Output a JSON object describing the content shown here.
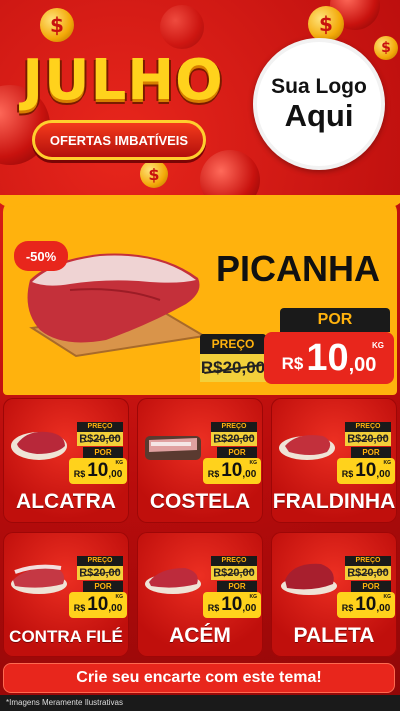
{
  "header": {
    "title": "JULHO",
    "subtitle": "OFERTAS IMBATÍVEIS",
    "logo_line1": "Sua Logo",
    "logo_line2": "Aqui",
    "coin_symbol": "$"
  },
  "featured": {
    "discount": "-50%",
    "name": "PICANHA",
    "old_label": "PREÇO",
    "old_price": "R$20,00",
    "new_label": "POR",
    "currency": "R$",
    "price_int": "10",
    "price_dec": ",00",
    "unit": "KG"
  },
  "products": [
    {
      "name": "ALCATRA",
      "old_label": "PREÇO",
      "old_price": "R$20,00",
      "new_label": "POR",
      "currency": "R$",
      "price_int": "10",
      "price_dec": ",00",
      "unit": "KG"
    },
    {
      "name": "COSTELA",
      "old_label": "PREÇO",
      "old_price": "R$20,00",
      "new_label": "POR",
      "currency": "R$",
      "price_int": "10",
      "price_dec": ",00",
      "unit": "KG"
    },
    {
      "name": "FRALDINHA",
      "old_label": "PREÇO",
      "old_price": "R$20,00",
      "new_label": "POR",
      "currency": "R$",
      "price_int": "10",
      "price_dec": ",00",
      "unit": "KG"
    },
    {
      "name": "CONTRA FILÉ",
      "old_label": "PREÇO",
      "old_price": "R$20,00",
      "new_label": "POR",
      "currency": "R$",
      "price_int": "10",
      "price_dec": ",00",
      "unit": "KG"
    },
    {
      "name": "ACÉM",
      "old_label": "PREÇO",
      "old_price": "R$20,00",
      "new_label": "POR",
      "currency": "R$",
      "price_int": "10",
      "price_dec": ",00",
      "unit": "KG"
    },
    {
      "name": "PALETA",
      "old_label": "PREÇO",
      "old_price": "R$20,00",
      "new_label": "POR",
      "currency": "R$",
      "price_int": "10",
      "price_dec": ",00",
      "unit": "KG"
    }
  ],
  "cta": "Crie seu encarte com este tema!",
  "footnote": "*Imagens Meramente Ilustrativas",
  "colors": {
    "primary_red": "#e8261c",
    "gold": "#ffb20d",
    "yellow": "#ffd21c",
    "dark": "#1a1a1a"
  },
  "icons": [
    "coin-dollar-icon",
    "meat-icon"
  ]
}
